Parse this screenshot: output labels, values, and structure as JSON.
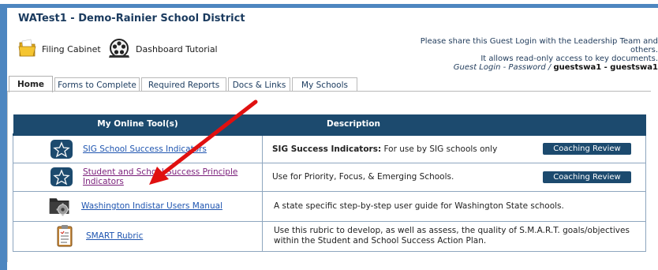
{
  "header": {
    "district_title": "WATest1 - Demo-Rainier School District",
    "filing_cabinet_label": "Filing Cabinet",
    "dashboard_tutorial_label": "Dashboard Tutorial",
    "share_line1": "Please share this Guest Login with the Leadership Team and others.",
    "share_line2": "It allows read-only access to key documents.",
    "credentials_prefix": "Guest Login - Password /",
    "credentials_value": "guestswa1 - guestswa1"
  },
  "tabs": [
    {
      "label": "Home"
    },
    {
      "label": "Forms to Complete"
    },
    {
      "label": "Required Reports"
    },
    {
      "label": "Docs & Links"
    },
    {
      "label": "My Schools"
    }
  ],
  "table": {
    "col_tool": "My Online Tool(s)",
    "col_desc": "Description",
    "rows": [
      {
        "tool": "SIG School Success Indicators",
        "desc_bold": "SIG Success Indicators:",
        "desc": " For use by SIG schools only",
        "button": "Coaching Review",
        "icon": "indistar-star-icon"
      },
      {
        "tool": "Student and School Success Principle Indicators",
        "desc_bold": "",
        "desc": "Use for Priority, Focus, & Emerging Schools.",
        "button": "Coaching Review",
        "icon": "indistar-star-icon"
      },
      {
        "tool": "Washington Indistar Users Manual",
        "desc_bold": "",
        "desc": "A state specific step-by-step user guide for Washington State schools.",
        "button": "",
        "icon": "folder-gear-icon"
      },
      {
        "tool": "SMART Rubric",
        "desc_bold": "",
        "desc": "Use this rubric to develop, as well as assess, the quality of S.M.A.R.T. goals/objectives within the Student and School Success Action Plan.",
        "button": "",
        "icon": "clipboard-icon"
      }
    ]
  },
  "colors": {
    "frame_blue": "#4d86c0",
    "header_navy": "#1c4a6e",
    "link_blue": "#1f55b0",
    "visited_purple": "#7a1e7a",
    "arrow_red": "#e01010"
  }
}
